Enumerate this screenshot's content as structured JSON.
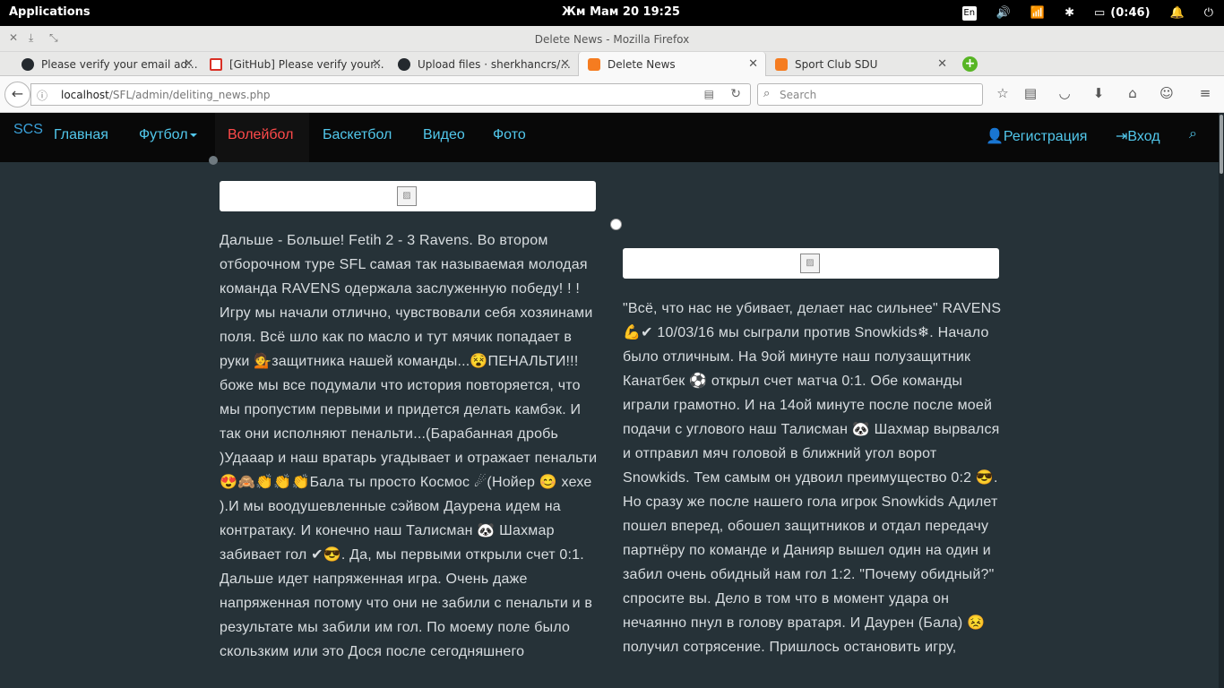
{
  "system_bar": {
    "applications": "Applications",
    "datetime": "Жм Мам 20   19:25",
    "lang": "En",
    "battery": "(0:46)"
  },
  "window": {
    "title": "Delete News - Mozilla Firefox"
  },
  "tabs": [
    {
      "label": "Please verify your email ad...",
      "favicon": "github-icon"
    },
    {
      "label": "[GitHub] Please verify your...",
      "favicon": "gmail-icon"
    },
    {
      "label": "Upload files · sherkhancrs/...",
      "favicon": "github-icon"
    },
    {
      "label": "Delete News",
      "favicon": "xampp-icon",
      "active": true
    },
    {
      "label": "Sport Club SDU",
      "favicon": "xampp-icon"
    }
  ],
  "urlbar": {
    "host": "localhost",
    "path": "/SFL/admin/deliting_news.php"
  },
  "search": {
    "placeholder": "Search"
  },
  "site_nav": {
    "brand": "SCS",
    "items": [
      "Главная",
      "Футбол",
      "Волейбол",
      "Баскетбол",
      "Видео",
      "Фото"
    ],
    "register": "Регистрация",
    "login": "Вход"
  },
  "news": [
    {
      "text": "Дальше - Больше! Fetih 2 - 3 Ravens. Во втором отборочном туре SFL самая так называемая молодая команда RAVENS одержала заслуженную победу! ! ! Игру мы начали отлично, чувствовали себя хозяинами поля. Всё шло как по масло и тут мячик попадает в руки 💁защитника нашей команды...😵ПЕНАЛЬТИ!!! боже мы все подумали что история повторяется, что мы пропустим первыми и придется делать камбэк. И так они исполняют пенальти...(Барабанная дробь )Удааар и наш вратарь угадывает и отражает пенальти 😍🙈👏👏👏Бала ты просто Космос ☄(Нойер 😊 хехе ).И мы воодушевленные сэйвом Даурена идем на контратаку. И конечно наш Талисман 🐼 Шахмар забивает гол ✔😎. Да, мы первыми открыли счет 0:1. Дальше идет напряженная игра. Очень даже напряженная потому что они не забили с пенальти и в результате мы забили им гол. По моему поле было скользким или это Дося после сегодняшнего"
    },
    {
      "text": "\"Всё, что нас не убивает, делает нас сильнее\" RAVENS 💪✔ 10/03/16 мы сыграли против Snowkids❄. Начало было отличным. На 9ой минуте наш полузащитник Канатбек ⚽ открыл счет матча 0:1. Обе команды играли грамотно. И на 14ой минуте после после моей подачи с углового наш Талисман 🐼 Шахмар вырвался и отправил мяч головой в ближний угол ворот Snowkids. Тем самым он удвоил преимущество 0:2 😎. Но сразу же после нашего гола игрок Snowkids Адилет пошел вперед, обошел защитников и отдал передачу партнёру по команде и Данияр вышел один на один и забил очень обидный нам гол 1:2. \"Почему обидный?\" спросите вы. Дело в том что в момент удара он нечаянно пнул в голову вратаря. И Даурен (Бала) 😣 получил сотрясение. Пришлось остановить игру,"
    }
  ]
}
